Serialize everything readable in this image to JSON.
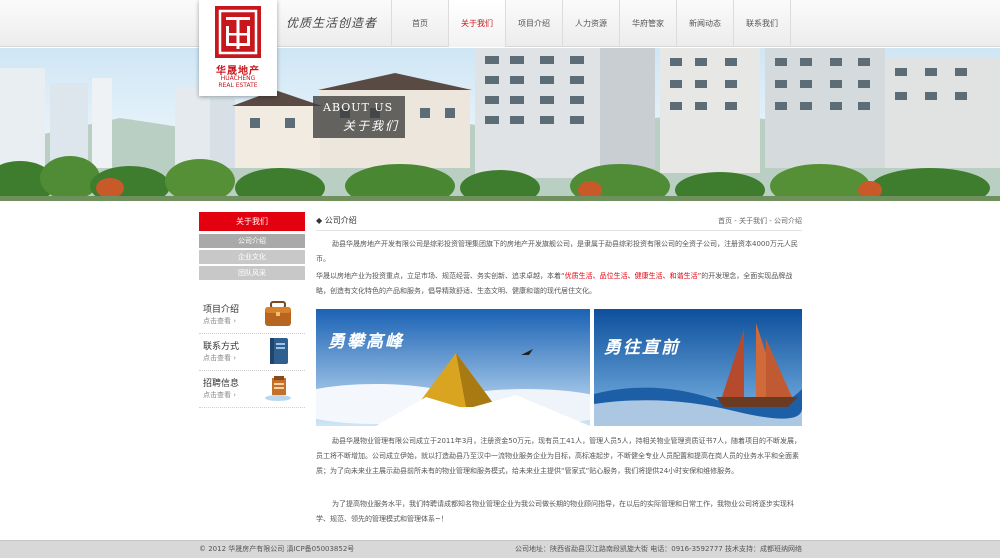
{
  "header": {
    "logo_cn": "华晟地产",
    "logo_en_line1": "HUACHENG",
    "logo_en_line2": "REAL ESTATE",
    "slogan": "优质生活创造者",
    "nav": [
      {
        "label": "首页"
      },
      {
        "label": "关于我们",
        "active": true
      },
      {
        "label": "项目介绍"
      },
      {
        "label": "人力资源"
      },
      {
        "label": "华府管家"
      },
      {
        "label": "新闻动态"
      },
      {
        "label": "联系我们"
      }
    ]
  },
  "banner": {
    "title_en": "ABOUT US",
    "title_cn": "关于我们"
  },
  "sidebar": {
    "title": "关于我们",
    "subnav": [
      "公司介绍",
      "企业文化",
      "团队风采"
    ],
    "boxes": [
      {
        "title": "项目介绍",
        "more": "点击查看 ›",
        "icon": "briefcase-icon"
      },
      {
        "title": "联系方式",
        "more": "点击查看 ›",
        "icon": "book-icon"
      },
      {
        "title": "招聘信息",
        "more": "点击查看 ›",
        "icon": "document-icon"
      }
    ]
  },
  "main": {
    "section_title": "公司介绍",
    "breadcrumb": "首页 - 关于我们 - 公司介绍",
    "p1": "勐县华晟房地产开发有限公司是综彩投资管理集团旗下的房地产开发旗舰公司，是隶属于勐县综彩投资有限公司的全资子公司，注册资本4000万元人民币。",
    "p2_before": "华晟以房地产业为投资重点，立足市场、规范经营、务实创新、追求卓越，本着",
    "p2_highlight": "“优质生活、品位生活、健康生活、和谐生活”",
    "p2_after": "的开发理念，全面实现品牌战略，创造有文化特色的产品和服务，倡导精致舒适、生态文明、健康和谐的现代居住文化。",
    "img1_text": "勇攀高峰",
    "img2_text": "勇往直前",
    "p3": "勐县华晟物业管理有限公司成立于2011年3月，注册资金50万元，现有员工41人，管理人员5人，持相关物业管理资质证书7人，随着项目的不断发展，员工将不断增加。公司成立伊始，就以打造勐县乃至汉中一流物业服务企业为目标，高标准起步，不断健全专业人员配置和提高在岗人员的业务水平和全面素质；为了向未来业主展示勐县前所未有的物业管理和服务模式，给未来业主提供“管家式”贴心服务，我们将提供24小时安保和维修服务。",
    "p4": "为了提高物业服务水平，我们特聘请成都知名物业管理企业为我公司做长期的物业顾问指导，在以后的实际管理和日常工作，我物业公司将逐步实现科学、规范、领先的管理模式和管理体系~！"
  },
  "footer": {
    "copyright": "© 2012 华晟房产有限公司 滇ICP备05003852号",
    "contact": "公司地址：陕西省勐县汉江路南段凯旋大街  电话：0916-3592777  技术支持：成都班纳网络"
  },
  "colors": {
    "accent_red": "#e3000f",
    "sidebar_gray": "#c8c8c8",
    "footer_gray": "#d8d8d8"
  }
}
